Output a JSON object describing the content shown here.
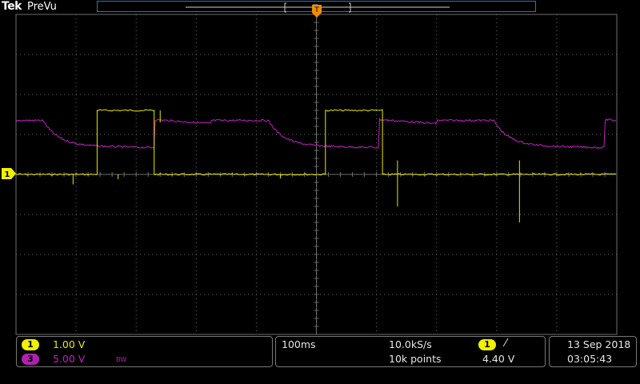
{
  "header": {
    "brand": "Tek",
    "mode": "PreVu"
  },
  "colors": {
    "ch1": "#e8e800",
    "ch3": "#c020c0",
    "grid": "#6e6e6e",
    "trigger_marker": "#f08c00",
    "record_frame": "#3a6fb0"
  },
  "channels": [
    {
      "number": "1",
      "scale": "1.00 V",
      "color": "#e8e800"
    },
    {
      "number": "3",
      "scale": "5.00 V",
      "color": "#c020c0",
      "bw_limit": "BW"
    }
  ],
  "ch1_marker": {
    "label": "1"
  },
  "timebase": {
    "scale": "100ms",
    "sample_rate": "10.0kS/s",
    "record_length": "10k points"
  },
  "trigger": {
    "source": "1",
    "slope_icon": "rising-edge-icon",
    "slope_glyph": "⁄",
    "level": "4.40 V"
  },
  "datetime": {
    "date": "13 Sep  2018",
    "time": "03:05:43"
  },
  "waveforms": {
    "ch1": {
      "low_level_div": 0.0,
      "high_level_div": 1.6,
      "edges_div": [
        1.35,
        2.3,
        5.15,
        6.1
      ],
      "starts_high": false
    },
    "ch3": {
      "high_level_div": 1.35,
      "settled_low_div": 0.72,
      "events_div": [
        0.45,
        2.3,
        3.25,
        4.2,
        6.1,
        7.0
      ]
    }
  }
}
